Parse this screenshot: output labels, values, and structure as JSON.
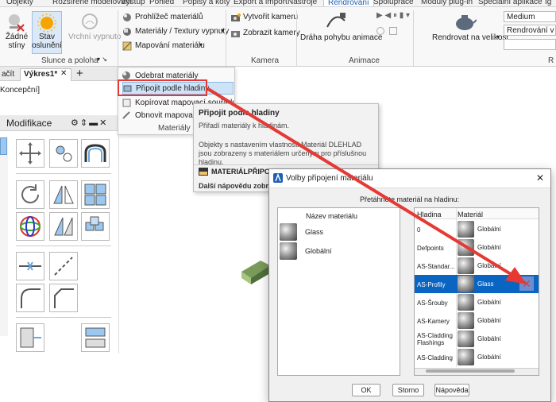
{
  "menubar": {
    "items": [
      "Objekty",
      "Rozšířené modelování",
      "Výstup",
      "Pohled",
      "Popisy a kóty",
      "Export a import",
      "Nástroje",
      "Rendrování",
      "Spolupráce",
      "Moduly plug-in",
      "Speciální aplikace",
      "Ig"
    ],
    "active": "Rendrování"
  },
  "ribbon": {
    "light": {
      "none_label": "Žádné\nstíny",
      "sun_label": "Stav\noslunění",
      "sky_label": "Vrchní vypnuto",
      "panel_title": "Slunce a poloha"
    },
    "materials": {
      "browser": "Prohlížeč materiálů",
      "textures": "Materiály / Textury vypnuty",
      "mapping": "Mapování materiálu"
    },
    "camera": {
      "create": "Vytvořit kameru",
      "show": "Zobrazit kamery",
      "panel_title": "Kamera"
    },
    "animation": {
      "path": "Dráha pohybu animace",
      "panel_title": "Animace"
    },
    "render": {
      "size": "Rendrovat na velikost",
      "quality": "Medium",
      "output": "Rendrování v okně",
      "panel_title": "R"
    }
  },
  "tabs": {
    "first": "ačít",
    "drawing": "Výkres1*"
  },
  "viewport": {
    "label": "Koncepční]"
  },
  "dropdown": {
    "items": [
      "Odebrat materiály",
      "Připojit podle hladiny",
      "Kopírovat mapovací souřadnice",
      "Obnovit mapovací souřadnice"
    ],
    "panel_title": "Materiály"
  },
  "tooltip": {
    "title": "Připojit podle hladiny",
    "short": "Přiřadí materiály k hladinám.",
    "desc": "Objekty s nastavením vlastnosti Materiál DLEHLAD jsou zobrazeny s materiálem určeným pro příslušnou hladinu.",
    "command": "MATERIÁLPŘIPOJ",
    "more": "Další nápovědu zobra"
  },
  "palette": {
    "title": "Modifikace"
  },
  "dialog": {
    "title": "Volby připojení materiálu",
    "instruction": "Přetáhněte materiál na hladinu:",
    "left": {
      "header": "Název materiálu",
      "items": [
        "Glass",
        "Globální"
      ]
    },
    "right": {
      "header_layer": "Hladina",
      "header_material": "Materiál",
      "rows": [
        {
          "layer": "0",
          "material": "Globální"
        },
        {
          "layer": "Defpoints",
          "material": "Globální"
        },
        {
          "layer": "AS-Standar...",
          "material": "Globální"
        },
        {
          "layer": "AS-Profily",
          "material": "Glass"
        },
        {
          "layer": "AS-Šrouby",
          "material": "Globální"
        },
        {
          "layer": "AS-Kamery",
          "material": "Globální"
        },
        {
          "layer": "AS-Cladding Flashings",
          "material": "Globální"
        },
        {
          "layer": "AS-Cladding",
          "material": "Globální"
        }
      ]
    },
    "buttons": {
      "ok": "OK",
      "cancel": "Storno",
      "help": "Nápověda"
    }
  },
  "colors": {
    "accent": "#1a5fb4",
    "selection": "#0a64c2",
    "highlight": "#e53935",
    "sun": "#f6a400"
  }
}
